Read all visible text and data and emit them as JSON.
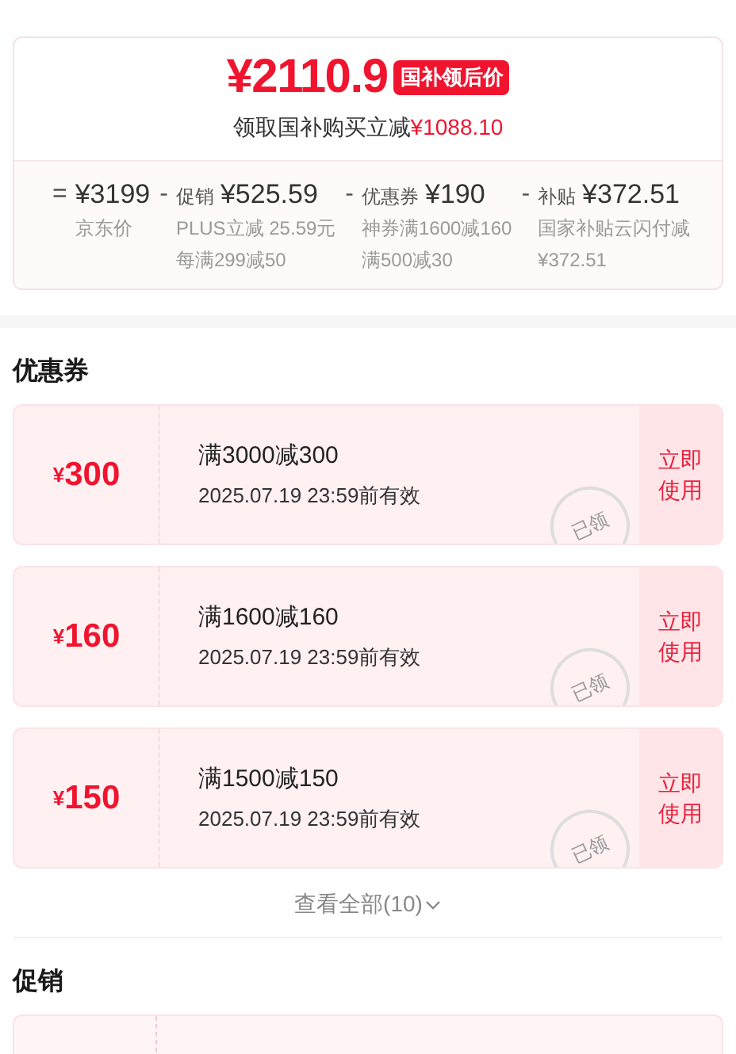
{
  "price_card": {
    "price": "¥2110.9",
    "badge": "国补领后价",
    "subtitle_prefix": "领取国补购买立减",
    "subtitle_amount": "¥1088.10",
    "breakdown": [
      {
        "operator": "=",
        "amount": "¥3199",
        "notes": [
          "京东价"
        ]
      },
      {
        "operator": "-",
        "label": "促销",
        "amount": "¥525.59",
        "notes": [
          "PLUS立减 25.59元",
          "每满299减50"
        ]
      },
      {
        "operator": "-",
        "label": "优惠券",
        "amount": "¥190",
        "notes": [
          "神券满1600减160",
          "满500减30"
        ]
      },
      {
        "operator": "-",
        "label": "补贴",
        "amount": "¥372.51",
        "notes": [
          "国家补贴云闪付减",
          "¥372.51"
        ]
      }
    ]
  },
  "coupons_section": {
    "title": "优惠券",
    "coupons": [
      {
        "currency": "¥",
        "value": "300",
        "condition": "满3000减300",
        "validity": "2025.07.19 23:59前有效",
        "stamp": "已领",
        "action": "立即使用"
      },
      {
        "currency": "¥",
        "value": "160",
        "condition": "满1600减160",
        "validity": "2025.07.19 23:59前有效",
        "stamp": "已领",
        "action": "立即使用"
      },
      {
        "currency": "¥",
        "value": "150",
        "condition": "满1500减150",
        "validity": "2025.07.19 23:59前有效",
        "stamp": "已领",
        "action": "立即使用"
      }
    ],
    "view_all": "查看全部(10)"
  },
  "promo_section": {
    "title": "促销"
  }
}
